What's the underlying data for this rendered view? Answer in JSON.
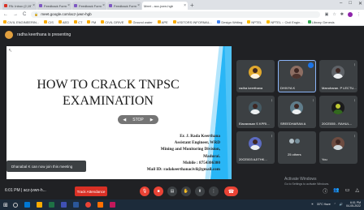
{
  "browser": {
    "tabs": [
      {
        "title": "PA: Inbox (2,197) - reloaderm.rs@su...",
        "active": false
      },
      {
        "title": "Feedback Form : How to crack T...",
        "active": false
      },
      {
        "title": "Feedback Form : How to crack T...",
        "active": false
      },
      {
        "title": "Feedback Form : How to crack T...",
        "active": false
      },
      {
        "title": "Meet - acz-jvwn-hgb",
        "active": true
      }
    ],
    "url": "meet.google.com/acz-jvwn-hgb",
    "bookmarks": [
      "CIVIL ENGINEERIN...",
      "CIS",
      "AED",
      "CT",
      "FM",
      "CIVIL DRIVE",
      "Ground water",
      "APE",
      "VISITORS INFORMAL...",
      "Design Writing",
      "NPTEL",
      "NPTEL :: Civil Engin...",
      "Library Genesis"
    ]
  },
  "meeting": {
    "presenter_label": "radha keerthana is presenting",
    "time": "6:01 PM",
    "code": "acz-jvwn-h...",
    "attendance_button": "Track Attendance",
    "toast": "Dhanabal K can now join this meeting"
  },
  "slide": {
    "title_line1": "HOW TO CRACK TNPSC",
    "title_line2": "EXAMINATION",
    "author_lines": [
      "Er. J. Rada Keerthana",
      "Assistant Engineer, WRD",
      "Mining and Monitoring Division,",
      "Madurai.",
      "Mobile : 8754306300",
      "Mail ID: radakeerthanacivil@gmail.com"
    ],
    "controls": [
      "◀",
      "STOP",
      "▶"
    ]
  },
  "participants": [
    {
      "name": "radha keerthana"
    },
    {
      "name": "DHIVYA K"
    },
    {
      "name": "Manoharan. P LECTU..."
    },
    {
      "name": "Elavarasan S KPRI..."
    },
    {
      "name": "SREEDHARAN A"
    },
    {
      "name": "20CE055 - RAHUL..."
    },
    {
      "name": "20CE003 AJITHK..."
    },
    {
      "name": "25 others"
    },
    {
      "name": "You"
    }
  ],
  "windows": {
    "activate_title": "Activate Windows",
    "activate_sub": "Go to Settings to activate Windows.",
    "weather": "33°C Haze",
    "clock_time": "6:01 PM",
    "clock_date": "04-05-2022"
  },
  "colors": {
    "meet_bg": "#202124",
    "tile_bg": "#3c4043",
    "red": "#ea4335",
    "slide_accent": "#29b6f6"
  }
}
